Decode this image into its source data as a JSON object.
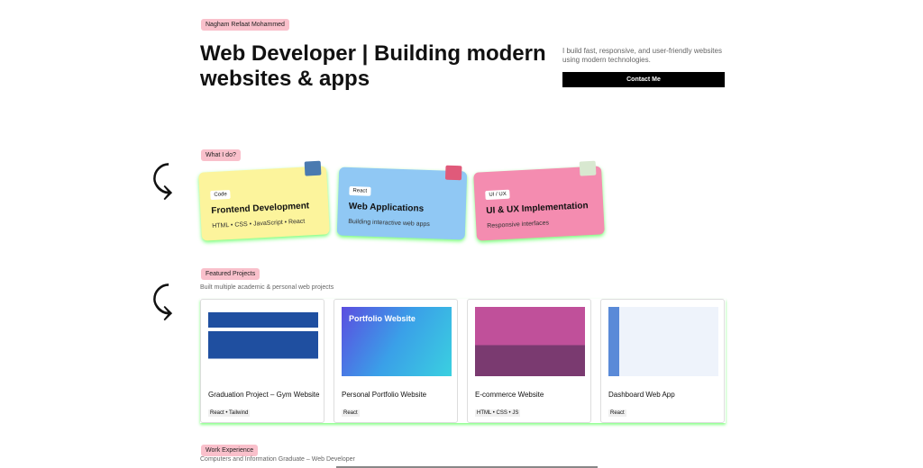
{
  "hero": {
    "name": "Nagham Refaat Mohammed",
    "title": "Web Developer | Building modern websites & apps",
    "intro": "I build fast, responsive, and user-friendly websites using modern technologies.",
    "contact": "Contact Me"
  },
  "services": {
    "label": "What I do?",
    "items": [
      {
        "chip": "Code",
        "title": "Frontend Development",
        "desc": "HTML • CSS • JavaScript • React",
        "color": "#fcf49c"
      },
      {
        "chip": "React",
        "title": "Web Applications",
        "desc": "Building interactive web apps",
        "color": "#90c8f4"
      },
      {
        "chip": "UI / UX",
        "title": "UI & UX Implementation",
        "desc": "Responsive interfaces",
        "color": "#f48cb0"
      }
    ]
  },
  "projects": {
    "label": "Featured Projects",
    "subtitle": "Built multiple academic & personal web projects",
    "items": [
      {
        "title": "Graduation Project – Gym Website",
        "tech": "React • Tailwind"
      },
      {
        "title": "Personal Portfolio Website",
        "tech": "React",
        "image_text": "Portfolio Website"
      },
      {
        "title": "E-commerce Website",
        "tech": "HTML • CSS • JS"
      },
      {
        "title": "Dashboard Web App",
        "tech": "React"
      }
    ]
  },
  "experience": {
    "label": "Work Experience",
    "subtitle": "Computers and Information Graduate – Web Developer"
  }
}
